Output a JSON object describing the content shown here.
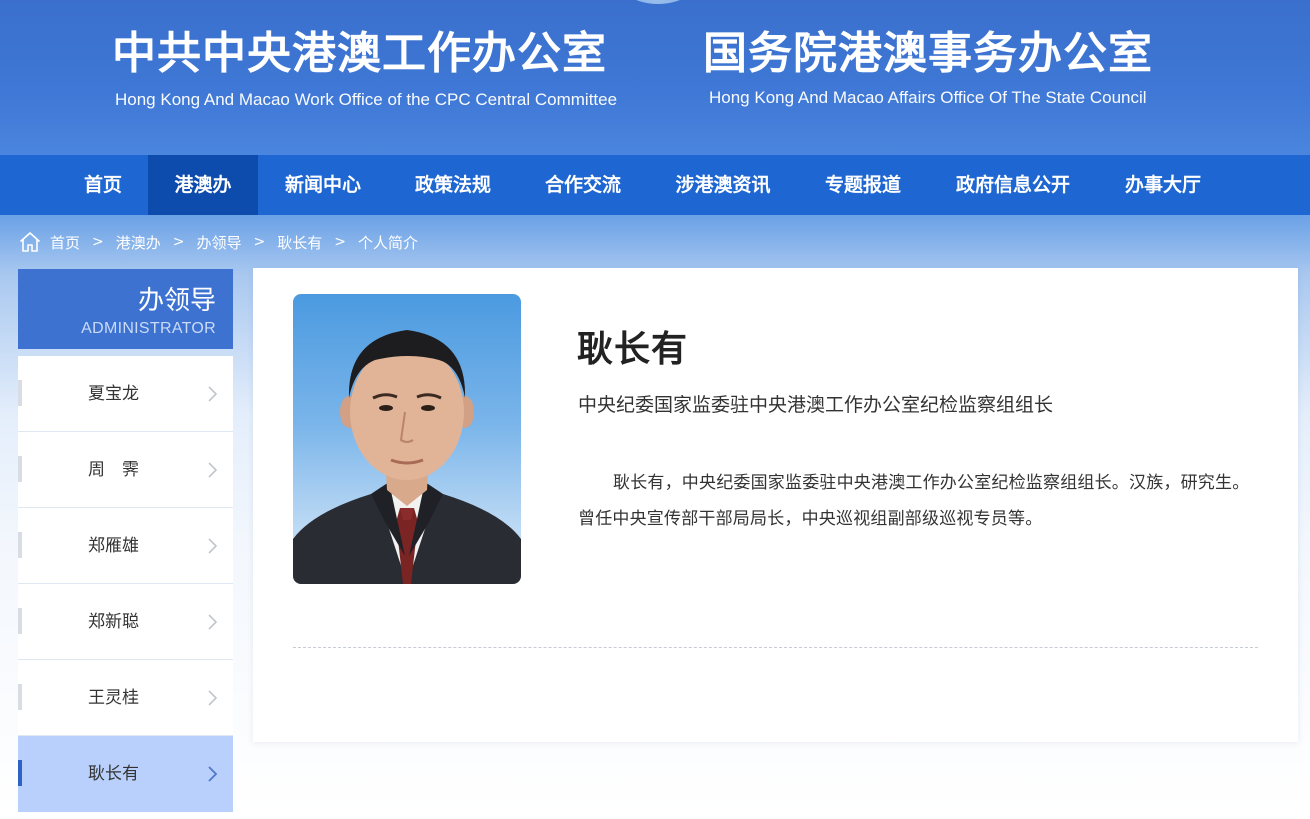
{
  "header": {
    "left_title_zh": "中共中央港澳工作办公室",
    "left_title_en": "Hong Kong And Macao Work Office of the CPC Central Committee",
    "right_title_zh": "国务院港澳事务办公室",
    "right_title_en": "Hong Kong And Macao Affairs Office Of The State Council"
  },
  "nav": {
    "items": [
      {
        "label": "首页"
      },
      {
        "label": "港澳办"
      },
      {
        "label": "新闻中心"
      },
      {
        "label": "政策法规"
      },
      {
        "label": "合作交流"
      },
      {
        "label": "涉港澳资讯"
      },
      {
        "label": "专题报道"
      },
      {
        "label": "政府信息公开"
      },
      {
        "label": "办事大厅"
      }
    ],
    "active": "港澳办"
  },
  "breadcrumb": {
    "icon": "home-icon",
    "separator": ">",
    "items": [
      "首页",
      "港澳办",
      "办领导",
      "耿长有",
      "个人简介"
    ]
  },
  "sidebar": {
    "title_zh": "办领导",
    "title_en": "ADMINISTRATOR",
    "items": [
      {
        "label": "夏宝龙"
      },
      {
        "label": "周　霁"
      },
      {
        "label": "郑雁雄"
      },
      {
        "label": "郑新聪"
      },
      {
        "label": "王灵桂"
      },
      {
        "label": "耿长有"
      }
    ],
    "active": "耿长有"
  },
  "profile": {
    "name": "耿长有",
    "position": "中央纪委国家监委驻中央港澳工作办公室纪检监察组组长",
    "bio": "耿长有，中央纪委国家监委驻中央港澳工作办公室纪检监察组组长。汉族，研究生。曾任中央宣传部干部局局长，中央巡视组副部级巡视专员等。"
  },
  "colors": {
    "header_blue": "#3f78d6",
    "nav_blue": "#1e66d2",
    "nav_active": "#0d4cad",
    "sidebar_head": "#3d72d1",
    "sidebar_active": "#b8d0fb"
  }
}
